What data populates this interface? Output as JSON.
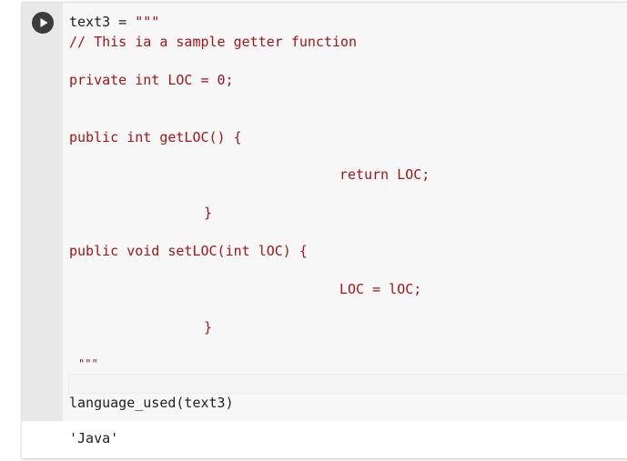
{
  "cell": {
    "run_icon": "play-icon",
    "lines": [
      {
        "prefix": "text3 = ",
        "text": "\"\"\""
      },
      {
        "text": "// This ia a sample getter function"
      },
      {
        "text": "private int LOC = 0;"
      },
      {
        "text": "public int getLOC() {"
      },
      {
        "text": "return LOC;"
      },
      {
        "text": "}"
      },
      {
        "text": "public void setLOC(int lOC) {"
      },
      {
        "text": "LOC = lOC;"
      },
      {
        "text": "}"
      },
      {
        "text": "\"\"\""
      },
      {
        "text": "language_used(text3)"
      }
    ]
  },
  "output": {
    "text": "'Java'"
  },
  "colors": {
    "string": "#a31515",
    "default_text": "#212121",
    "gutter": "#e8e8e8",
    "editor_bg": "#f7f7f7"
  }
}
